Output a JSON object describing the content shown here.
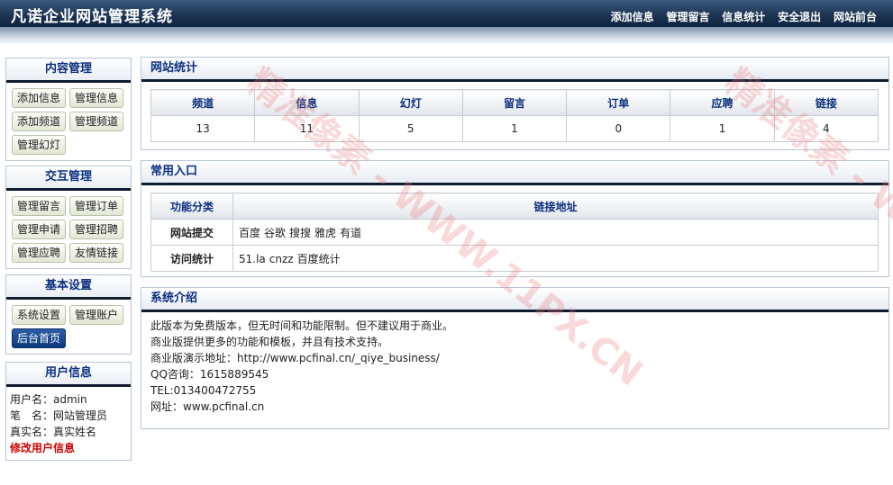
{
  "header": {
    "title": "凡诺企业网站管理系统",
    "nav": [
      "添加信息",
      "管理留言",
      "信息统计",
      "安全退出",
      "网站前台"
    ]
  },
  "sidebar": {
    "content": {
      "title": "内容管理",
      "buttons": [
        "添加信息",
        "管理信息",
        "添加频道",
        "管理频道",
        "管理幻灯"
      ]
    },
    "interaction": {
      "title": "交互管理",
      "buttons": [
        "管理留言",
        "管理订单",
        "管理申请",
        "管理招聘",
        "管理应聘",
        "友情链接"
      ]
    },
    "settings": {
      "title": "基本设置",
      "buttons": [
        "系统设置",
        "管理账户",
        "后台首页"
      ]
    },
    "user": {
      "title": "用户信息",
      "username": "用户名：admin",
      "nickname": "笔　名：网站管理员",
      "realname": "真实名：真实姓名",
      "edit_link": "修改用户信息"
    }
  },
  "stats": {
    "title": "网站统计",
    "headers": [
      "频道",
      "信息",
      "幻灯",
      "留言",
      "订单",
      "应聘",
      "链接"
    ],
    "values": [
      "13",
      "11",
      "5",
      "1",
      "0",
      "1",
      "4"
    ]
  },
  "entries": {
    "title": "常用入口",
    "headers": [
      "功能分类",
      "链接地址"
    ],
    "rows": [
      {
        "category": "网站提交",
        "links": [
          "百度",
          "谷歌",
          "搜搜",
          "雅虎",
          "有道"
        ]
      },
      {
        "category": "访问统计",
        "links": [
          "51.la",
          "cnzz",
          "百度统计"
        ]
      }
    ]
  },
  "intro": {
    "title": "系统介绍",
    "lines": [
      "此版本为免费版本，但无时间和功能限制。但不建议用于商业。",
      "商业版提供更多的功能和模板，并且有技术支持。",
      "商业版演示地址：http://www.pcfinal.cn/_qiye_business/",
      "QQ咨询：1615889545",
      "TEL:013400472755",
      "网址：www.pcfinal.cn"
    ]
  },
  "watermark": "精准像素 - WWW.11PX.CN"
}
